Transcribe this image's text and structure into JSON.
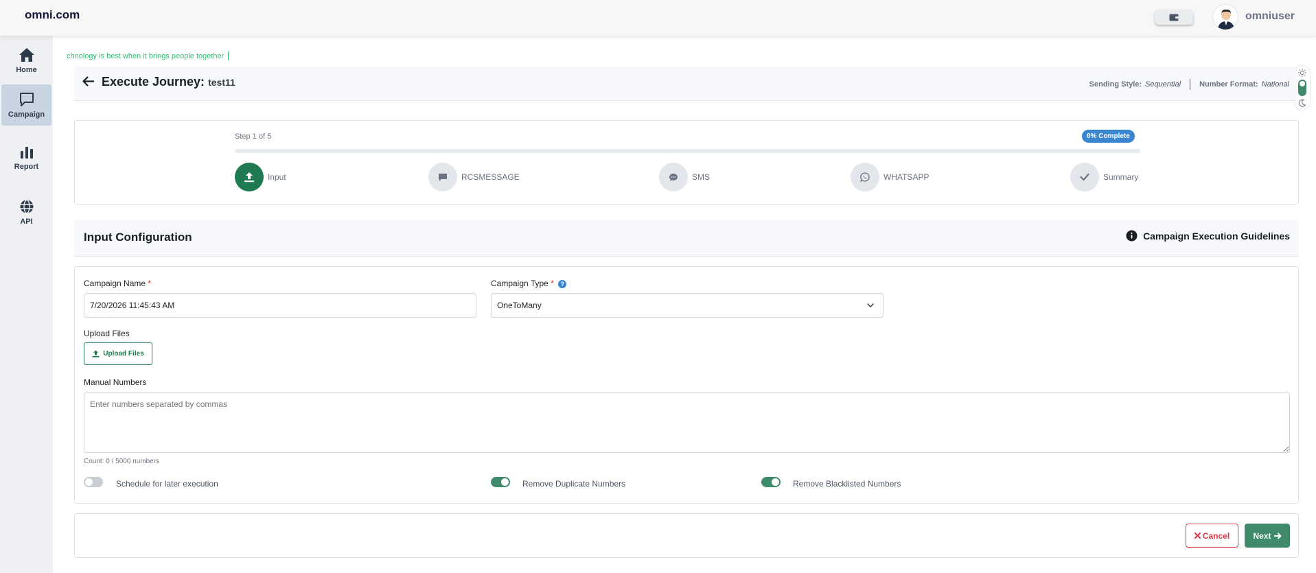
{
  "app": {
    "brand": "omni.com",
    "username": "omniuser"
  },
  "colors": {
    "accent_green": "#3e8a6a",
    "primary_blue": "#3b86d1",
    "danger": "#dc3545"
  },
  "sidebar": {
    "items": [
      {
        "label": "Home",
        "icon": "home-icon",
        "active": false
      },
      {
        "label": "Campaign",
        "icon": "chat-icon",
        "active": true
      },
      {
        "label": "Report",
        "icon": "bar-chart-icon",
        "active": false
      },
      {
        "label": "API",
        "icon": "globe-icon",
        "active": false
      }
    ]
  },
  "marquee": {
    "text": "chnology is best when it brings people together"
  },
  "journey": {
    "title_prefix": "Execute Journey:",
    "name": "test11",
    "sending_style_label": "Sending Style:",
    "sending_style_value": "Sequential",
    "number_format_label": "Number Format:",
    "number_format_value": "National"
  },
  "stepper": {
    "step_text": "Step 1 of 5",
    "complete_text": "0% Complete",
    "progress_percent": 0,
    "steps": [
      {
        "label": "Input",
        "icon": "upload-icon",
        "active": true
      },
      {
        "label": "RCSMESSAGE",
        "icon": "message-icon",
        "active": false
      },
      {
        "label": "SMS",
        "icon": "sms-icon",
        "active": false
      },
      {
        "label": "WHATSAPP",
        "icon": "whatsapp-icon",
        "active": false
      },
      {
        "label": "Summary",
        "icon": "check-icon",
        "active": false
      }
    ]
  },
  "config": {
    "title": "Input Configuration",
    "guidelines_label": "Campaign Execution Guidelines"
  },
  "form": {
    "campaign_name_label": "Campaign Name",
    "campaign_name_value": "7/20/2026 11:45:43 AM",
    "required_mark": "*",
    "campaign_type_label": "Campaign Type",
    "campaign_type_value": "OneToMany",
    "help_glyph": "?",
    "upload_label": "Upload Files",
    "upload_button": "Upload Files",
    "manual_label": "Manual Numbers",
    "manual_placeholder": "Enter numbers separated by commas",
    "count_text": "Count: 0 / 5000 numbers",
    "toggles": [
      {
        "label": "Schedule for later execution",
        "on": false
      },
      {
        "label": "Remove Duplicate Numbers",
        "on": true
      },
      {
        "label": "Remove Blacklisted Numbers",
        "on": true
      }
    ]
  },
  "footer": {
    "cancel_label": "Cancel",
    "next_label": "Next"
  }
}
